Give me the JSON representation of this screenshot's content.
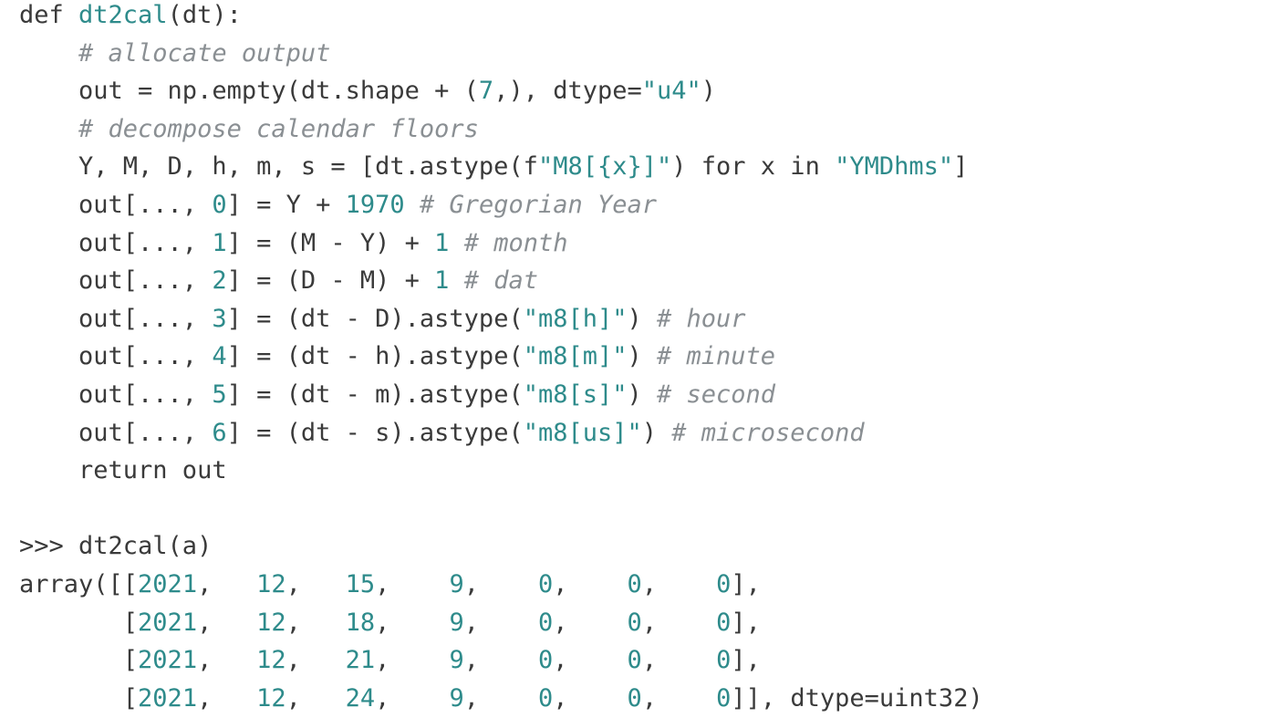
{
  "lines": [
    [
      {
        "t": "kw",
        "s": "def "
      },
      {
        "t": "fn",
        "s": "dt2cal"
      },
      {
        "t": "tx",
        "s": "(dt):"
      }
    ],
    [
      {
        "t": "tx",
        "s": "    "
      },
      {
        "t": "cm",
        "s": "# allocate output"
      }
    ],
    [
      {
        "t": "tx",
        "s": "    out = np.empty(dt.shape + ("
      },
      {
        "t": "num",
        "s": "7"
      },
      {
        "t": "tx",
        "s": ",), dtype="
      },
      {
        "t": "str",
        "s": "\"u4\""
      },
      {
        "t": "tx",
        "s": ")"
      }
    ],
    [
      {
        "t": "tx",
        "s": "    "
      },
      {
        "t": "cm",
        "s": "# decompose calendar floors"
      }
    ],
    [
      {
        "t": "tx",
        "s": "    Y, M, D, h, m, s = [dt.astype(f"
      },
      {
        "t": "str",
        "s": "\"M8[{x}]\""
      },
      {
        "t": "tx",
        "s": ") for x in "
      },
      {
        "t": "str",
        "s": "\"YMDhms\""
      },
      {
        "t": "tx",
        "s": "]"
      }
    ],
    [
      {
        "t": "tx",
        "s": "    out[..., "
      },
      {
        "t": "num",
        "s": "0"
      },
      {
        "t": "tx",
        "s": "] = Y + "
      },
      {
        "t": "num",
        "s": "1970"
      },
      {
        "t": "tx",
        "s": " "
      },
      {
        "t": "cm",
        "s": "# Gregorian Year"
      }
    ],
    [
      {
        "t": "tx",
        "s": "    out[..., "
      },
      {
        "t": "num",
        "s": "1"
      },
      {
        "t": "tx",
        "s": "] = (M - Y) + "
      },
      {
        "t": "num",
        "s": "1"
      },
      {
        "t": "tx",
        "s": " "
      },
      {
        "t": "cm",
        "s": "# month"
      }
    ],
    [
      {
        "t": "tx",
        "s": "    out[..., "
      },
      {
        "t": "num",
        "s": "2"
      },
      {
        "t": "tx",
        "s": "] = (D - M) + "
      },
      {
        "t": "num",
        "s": "1"
      },
      {
        "t": "tx",
        "s": " "
      },
      {
        "t": "cm",
        "s": "# dat"
      }
    ],
    [
      {
        "t": "tx",
        "s": "    out[..., "
      },
      {
        "t": "num",
        "s": "3"
      },
      {
        "t": "tx",
        "s": "] = (dt - D).astype("
      },
      {
        "t": "str",
        "s": "\"m8[h]\""
      },
      {
        "t": "tx",
        "s": ") "
      },
      {
        "t": "cm",
        "s": "# hour"
      }
    ],
    [
      {
        "t": "tx",
        "s": "    out[..., "
      },
      {
        "t": "num",
        "s": "4"
      },
      {
        "t": "tx",
        "s": "] = (dt - h).astype("
      },
      {
        "t": "str",
        "s": "\"m8[m]\""
      },
      {
        "t": "tx",
        "s": ") "
      },
      {
        "t": "cm",
        "s": "# minute"
      }
    ],
    [
      {
        "t": "tx",
        "s": "    out[..., "
      },
      {
        "t": "num",
        "s": "5"
      },
      {
        "t": "tx",
        "s": "] = (dt - m).astype("
      },
      {
        "t": "str",
        "s": "\"m8[s]\""
      },
      {
        "t": "tx",
        "s": ") "
      },
      {
        "t": "cm",
        "s": "# second"
      }
    ],
    [
      {
        "t": "tx",
        "s": "    out[..., "
      },
      {
        "t": "num",
        "s": "6"
      },
      {
        "t": "tx",
        "s": "] = (dt - s).astype("
      },
      {
        "t": "str",
        "s": "\"m8[us]\""
      },
      {
        "t": "tx",
        "s": ") "
      },
      {
        "t": "cm",
        "s": "# microsecond"
      }
    ],
    [
      {
        "t": "tx",
        "s": "    return out"
      }
    ],
    [],
    [
      {
        "t": "tx",
        "s": ">>> dt2cal(a)"
      }
    ],
    [
      {
        "t": "tx",
        "s": "array([["
      },
      {
        "t": "num",
        "s": "2021"
      },
      {
        "t": "tx",
        "s": ",   "
      },
      {
        "t": "num",
        "s": "12"
      },
      {
        "t": "tx",
        "s": ",   "
      },
      {
        "t": "num",
        "s": "15"
      },
      {
        "t": "tx",
        "s": ",    "
      },
      {
        "t": "num",
        "s": "9"
      },
      {
        "t": "tx",
        "s": ",    "
      },
      {
        "t": "num",
        "s": "0"
      },
      {
        "t": "tx",
        "s": ",    "
      },
      {
        "t": "num",
        "s": "0"
      },
      {
        "t": "tx",
        "s": ",    "
      },
      {
        "t": "num",
        "s": "0"
      },
      {
        "t": "tx",
        "s": "],"
      }
    ],
    [
      {
        "t": "tx",
        "s": "       ["
      },
      {
        "t": "num",
        "s": "2021"
      },
      {
        "t": "tx",
        "s": ",   "
      },
      {
        "t": "num",
        "s": "12"
      },
      {
        "t": "tx",
        "s": ",   "
      },
      {
        "t": "num",
        "s": "18"
      },
      {
        "t": "tx",
        "s": ",    "
      },
      {
        "t": "num",
        "s": "9"
      },
      {
        "t": "tx",
        "s": ",    "
      },
      {
        "t": "num",
        "s": "0"
      },
      {
        "t": "tx",
        "s": ",    "
      },
      {
        "t": "num",
        "s": "0"
      },
      {
        "t": "tx",
        "s": ",    "
      },
      {
        "t": "num",
        "s": "0"
      },
      {
        "t": "tx",
        "s": "],"
      }
    ],
    [
      {
        "t": "tx",
        "s": "       ["
      },
      {
        "t": "num",
        "s": "2021"
      },
      {
        "t": "tx",
        "s": ",   "
      },
      {
        "t": "num",
        "s": "12"
      },
      {
        "t": "tx",
        "s": ",   "
      },
      {
        "t": "num",
        "s": "21"
      },
      {
        "t": "tx",
        "s": ",    "
      },
      {
        "t": "num",
        "s": "9"
      },
      {
        "t": "tx",
        "s": ",    "
      },
      {
        "t": "num",
        "s": "0"
      },
      {
        "t": "tx",
        "s": ",    "
      },
      {
        "t": "num",
        "s": "0"
      },
      {
        "t": "tx",
        "s": ",    "
      },
      {
        "t": "num",
        "s": "0"
      },
      {
        "t": "tx",
        "s": "],"
      }
    ],
    [
      {
        "t": "tx",
        "s": "       ["
      },
      {
        "t": "num",
        "s": "2021"
      },
      {
        "t": "tx",
        "s": ",   "
      },
      {
        "t": "num",
        "s": "12"
      },
      {
        "t": "tx",
        "s": ",   "
      },
      {
        "t": "num",
        "s": "24"
      },
      {
        "t": "tx",
        "s": ",    "
      },
      {
        "t": "num",
        "s": "9"
      },
      {
        "t": "tx",
        "s": ",    "
      },
      {
        "t": "num",
        "s": "0"
      },
      {
        "t": "tx",
        "s": ",    "
      },
      {
        "t": "num",
        "s": "0"
      },
      {
        "t": "tx",
        "s": ",    "
      },
      {
        "t": "num",
        "s": "0"
      },
      {
        "t": "tx",
        "s": "]], dtype=uint32)"
      }
    ]
  ]
}
